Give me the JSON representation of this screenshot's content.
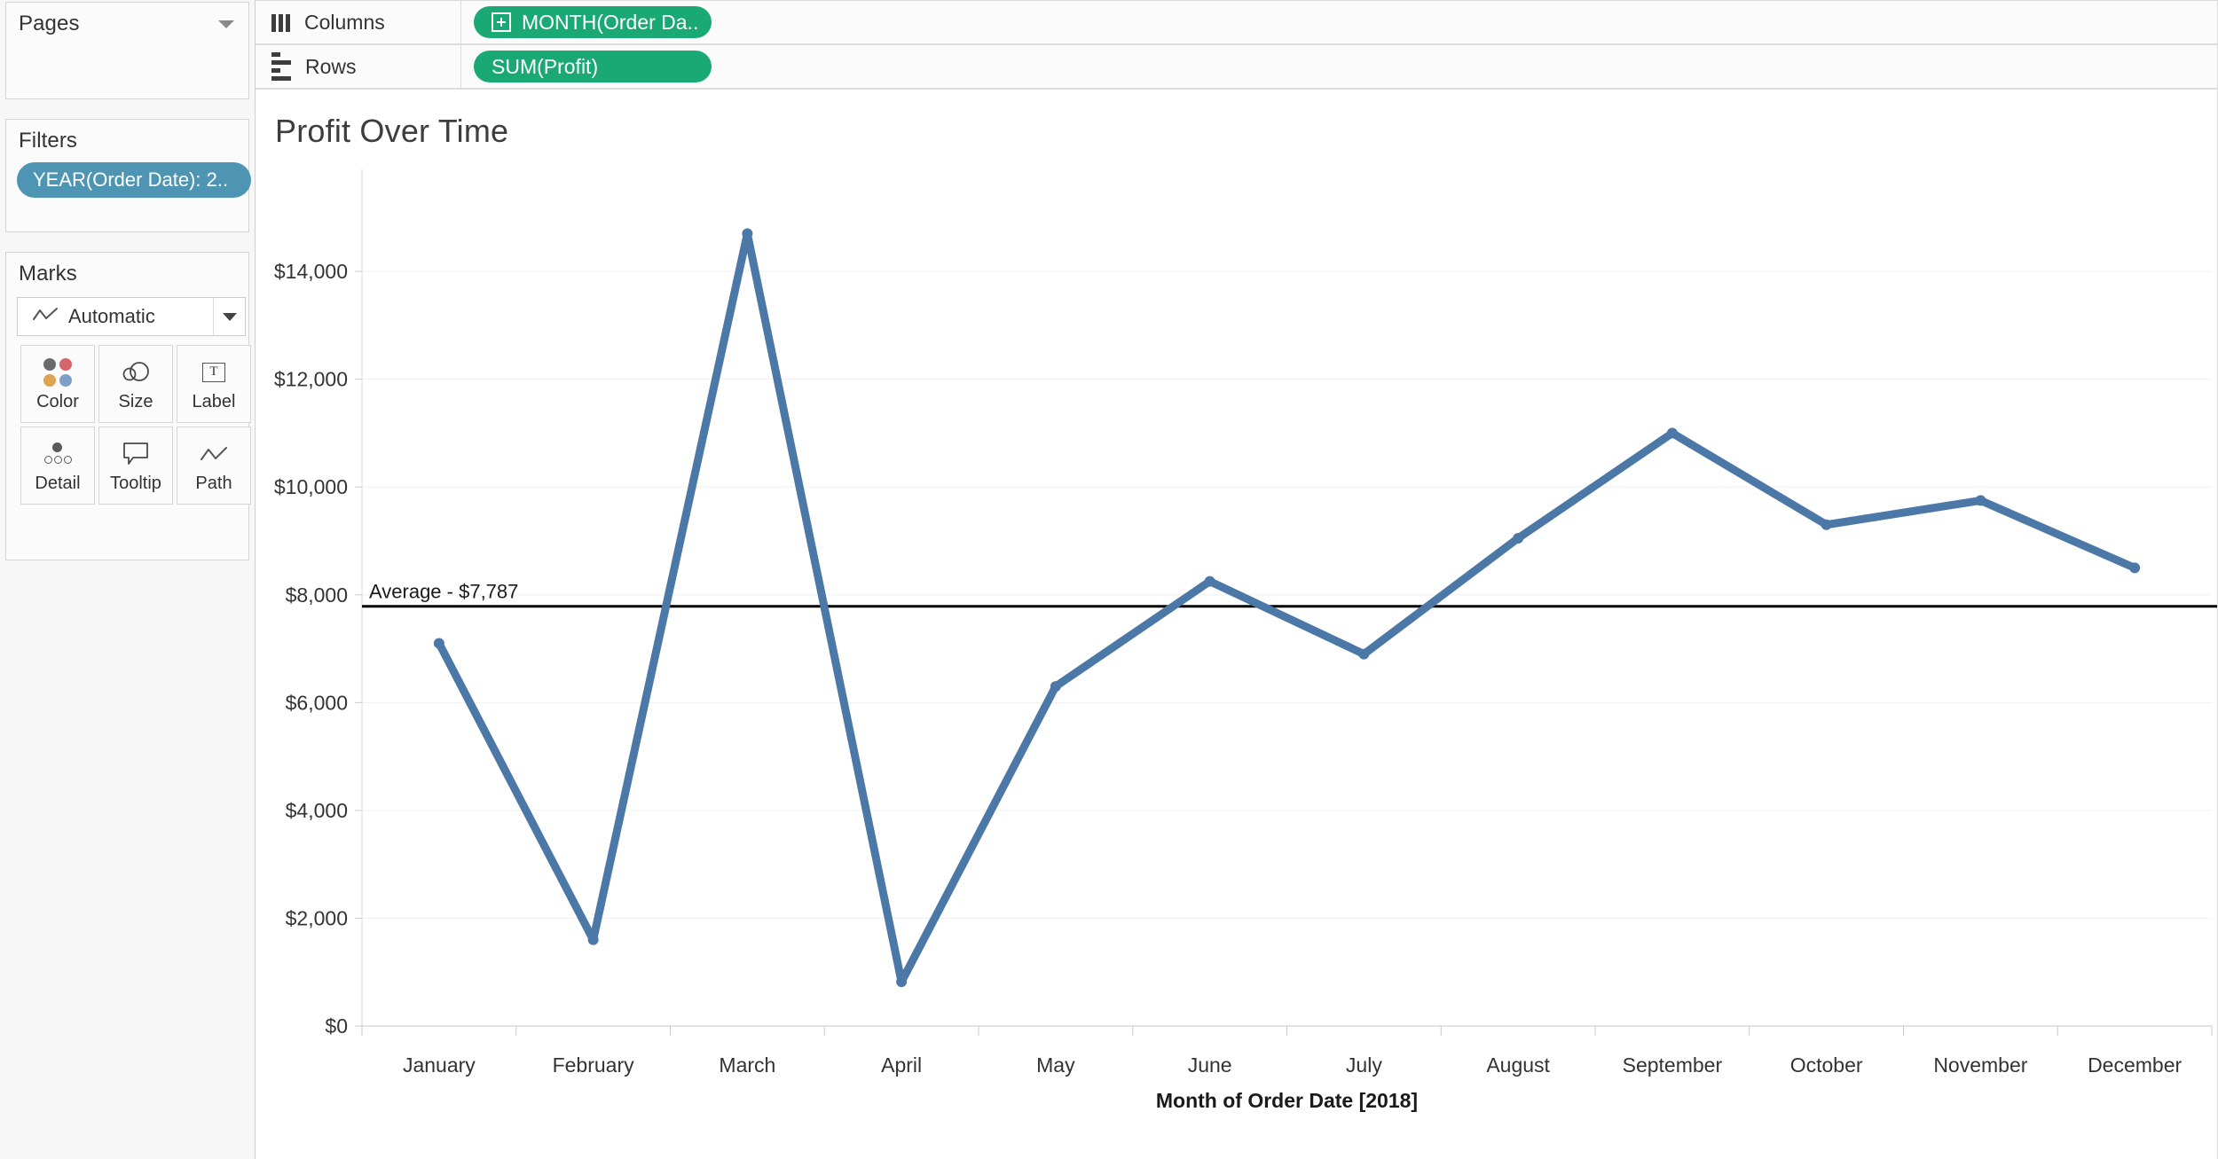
{
  "sidebar": {
    "pages": {
      "title": "Pages"
    },
    "filters": {
      "title": "Filters",
      "pills": [
        {
          "label": "YEAR(Order Date): 2..",
          "color": "#4e95b3"
        }
      ]
    },
    "marks": {
      "title": "Marks",
      "mark_type": "Automatic",
      "mark_type_icon": "line-chart-icon",
      "buttons": [
        {
          "label": "Color",
          "icon": "color-dots-icon"
        },
        {
          "label": "Size",
          "icon": "size-circles-icon"
        },
        {
          "label": "Label",
          "icon": "label-text-icon"
        },
        {
          "label": "Detail",
          "icon": "detail-dots-icon"
        },
        {
          "label": "Tooltip",
          "icon": "tooltip-bubble-icon"
        },
        {
          "label": "Path",
          "icon": "path-line-icon"
        }
      ],
      "color_dots": [
        "#6b6b6b",
        "#d4656b",
        "#e0a450",
        "#7f9fc4"
      ]
    }
  },
  "shelves": {
    "columns": {
      "label": "Columns",
      "icon": "columns-icon",
      "pill": "MONTH(Order Da..",
      "pill_icon": "plus-box-icon",
      "pill_color": "#1aa974"
    },
    "rows": {
      "label": "Rows",
      "icon": "rows-icon",
      "pill": "SUM(Profit)",
      "pill_icon": "",
      "pill_color": "#1aa974"
    }
  },
  "viz": {
    "title": "Profit Over Time"
  },
  "chart_data": {
    "type": "line",
    "title": "Profit Over Time",
    "xlabel": "Month of Order Date [2018]",
    "ylabel": "",
    "categories": [
      "January",
      "February",
      "March",
      "April",
      "May",
      "June",
      "July",
      "August",
      "September",
      "October",
      "November",
      "December"
    ],
    "values": [
      7100,
      1600,
      14700,
      820,
      6300,
      8250,
      6900,
      9050,
      11000,
      9300,
      9750,
      8500
    ],
    "ylim": [
      0,
      15400
    ],
    "yticks": [
      0,
      2000,
      4000,
      6000,
      8000,
      10000,
      12000,
      14000
    ],
    "ytick_labels": [
      "$0",
      "$2,000",
      "$4,000",
      "$6,000",
      "$8,000",
      "$10,000",
      "$12,000",
      "$14,000"
    ],
    "grid": true,
    "legend": "none",
    "series_color": "#4c78a8",
    "reference_line": {
      "label": "Average - $7,787",
      "value": 7787,
      "color": "#000000"
    }
  }
}
